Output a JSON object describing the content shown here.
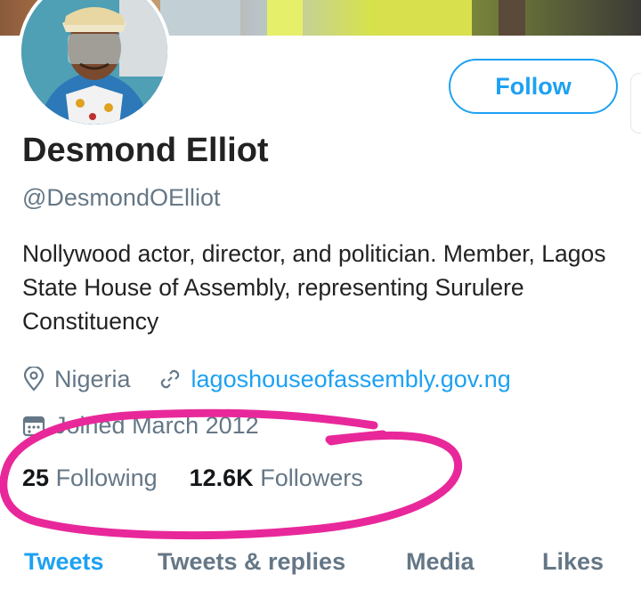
{
  "profile": {
    "name": "Desmond Elliot",
    "handle": "@DesmondOElliot",
    "bio": "Nollywood actor, director, and politician. Member, Lagos State House of Assembly, representing Surulere Constituency",
    "location": "Nigeria",
    "website": "lagoshouseofassembly.gov.ng",
    "joined": "Joined March 2012",
    "following_count": "25",
    "following_label": "Following",
    "followers_count": "12.6K",
    "followers_label": "Followers"
  },
  "actions": {
    "follow_label": "Follow"
  },
  "tabs": [
    {
      "label": "Tweets",
      "active": true
    },
    {
      "label": "Tweets & replies",
      "active": false
    },
    {
      "label": "Media",
      "active": false
    },
    {
      "label": "Likes",
      "active": false
    }
  ],
  "icons": {
    "location": "location-pin-icon",
    "link": "link-icon",
    "calendar": "calendar-icon"
  },
  "colors": {
    "accent": "#1da1f2",
    "secondary_text": "#657786",
    "annotation": "#e8289a"
  }
}
